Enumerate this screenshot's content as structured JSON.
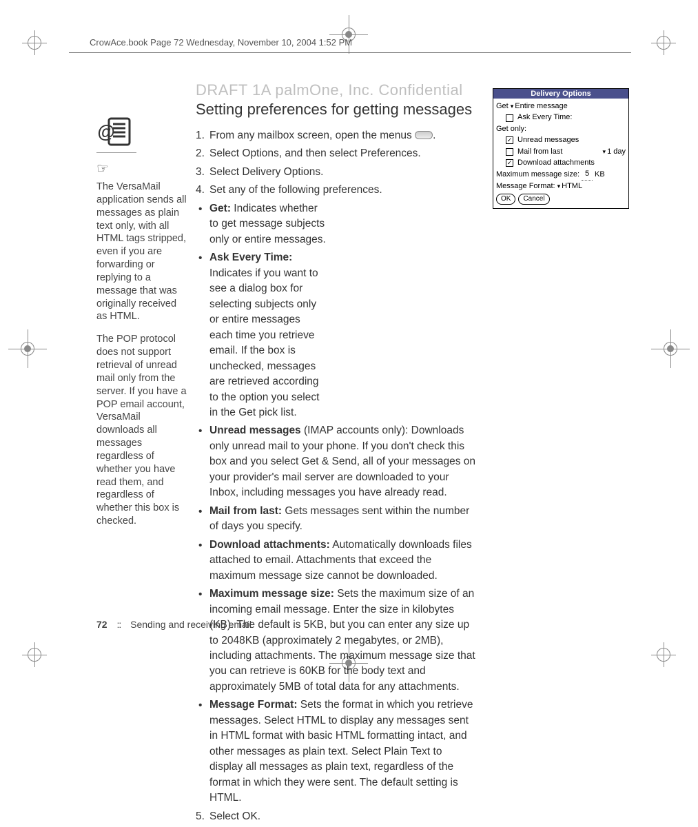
{
  "running_head": "CrowAce.book  Page 72  Wednesday, November 10, 2004  1:52 PM",
  "watermark": "DRAFT 1A  palmOne, Inc.   Confidential",
  "heading": "Setting preferences for getting messages",
  "steps": {
    "s1_pre": "From any mailbox screen, open the menus ",
    "s1_post": ".",
    "s2": "Select Options, and then select Preferences.",
    "s3": "Select Delivery Options.",
    "s4": "Set any of the following preferences.",
    "s5": "Select OK."
  },
  "bullets": {
    "get": {
      "label": "Get:",
      "text": " Indicates whether to get message subjects only or entire messages."
    },
    "ask": {
      "label": "Ask Every Time:",
      "text": " Indicates if you want to see a dialog box for selecting subjects only or entire messages each time you retrieve email. If the box is unchecked, messages are retrieved according to the option you select in the Get pick list."
    },
    "unread": {
      "label": "Unread messages",
      "suffix": " (IMAP accounts only):",
      "text": " Downloads only unread mail to your phone. If you don't check this box and you select Get & Send, all of your messages on your provider's mail server are downloaded to your Inbox, including messages you have already read."
    },
    "mail_from_last": {
      "label": "Mail from last:",
      "text": " Gets messages sent within the number of days you specify."
    },
    "download": {
      "label": "Download attachments:",
      "text": " Automatically downloads files attached to email. Attachments that exceed the maximum message size cannot be downloaded."
    },
    "maxsize": {
      "label": "Maximum message size:",
      "text": " Sets the maximum size of an incoming email message. Enter the size in kilobytes (KB). The default is 5KB, but you can enter any size up to 2048KB (approximately 2 megabytes, or 2MB), including attachments. The maximum message size that you can retrieve is 60KB for the body text and approximately 5MB of total data for any attachments."
    },
    "format": {
      "label": "Message Format:",
      "text": " Sets the format in which you retrieve messages. Select HTML to display any messages sent in HTML format with basic HTML formatting intact, and other messages as plain text. Select Plain Text to display all messages as plain text, regardless of the format in which they were sent. The default setting is HTML."
    }
  },
  "sidebar": {
    "p1": "The VersaMail application sends all messages as plain text only, with all HTML tags stripped, even if you are forwarding or replying to a message that was originally received as HTML.",
    "p2": "The POP protocol does not support retrieval of unread mail only from the server. If you have a POP email account, VersaMail downloads all messages regardless of whether you have read them, and regardless of whether this box is checked."
  },
  "palm": {
    "title": "Delivery Options",
    "get_label": "Get",
    "get_value": "Entire message",
    "ask_label": "Ask Every Time:",
    "get_only": "Get only:",
    "unread": "Unread messages",
    "mail_from_last": "Mail from last",
    "mail_from_last_val": "1 day",
    "download_attach": "Download attachments",
    "max_size_label": "Maximum message size:",
    "max_size_val": "5",
    "max_size_unit": "KB",
    "msg_format_label": "Message Format:",
    "msg_format_val": "HTML",
    "ok": "OK",
    "cancel": "Cancel"
  },
  "footer": {
    "page": "72",
    "sep": "::",
    "chapter": "Sending and receiving email"
  }
}
